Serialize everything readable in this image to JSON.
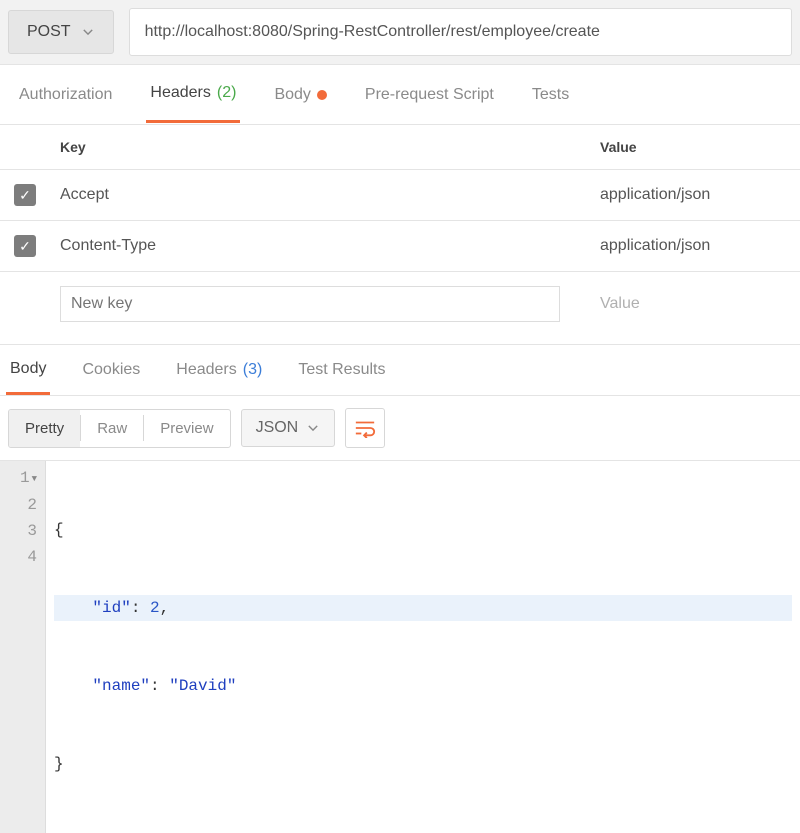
{
  "request": {
    "method": "POST",
    "url": "http://localhost:8080/Spring-RestController/rest/employee/create"
  },
  "req_tabs": {
    "authorization": "Authorization",
    "headers": "Headers",
    "headers_count": "(2)",
    "body": "Body",
    "prereq": "Pre-request Script",
    "tests": "Tests"
  },
  "headers_table": {
    "col_key": "Key",
    "col_value": "Value",
    "rows": [
      {
        "key": "Accept",
        "value": "application/json"
      },
      {
        "key": "Content-Type",
        "value": "application/json"
      }
    ],
    "new_key_placeholder": "New key",
    "new_value_placeholder": "Value"
  },
  "resp_tabs": {
    "body": "Body",
    "cookies": "Cookies",
    "headers": "Headers",
    "headers_count": "(3)",
    "tests": "Test Results"
  },
  "toolbar": {
    "pretty": "Pretty",
    "raw": "Raw",
    "preview": "Preview",
    "format": "JSON"
  },
  "code": {
    "line1": "{",
    "line2_key": "\"id\"",
    "line2_sep": ": ",
    "line2_val": "2",
    "line2_end": ",",
    "line3_key": "\"name\"",
    "line3_sep": ": ",
    "line3_val": "\"David\"",
    "line4": "}",
    "gutter": {
      "l1": "1",
      "l2": "2",
      "l3": "3",
      "l4": "4"
    }
  }
}
